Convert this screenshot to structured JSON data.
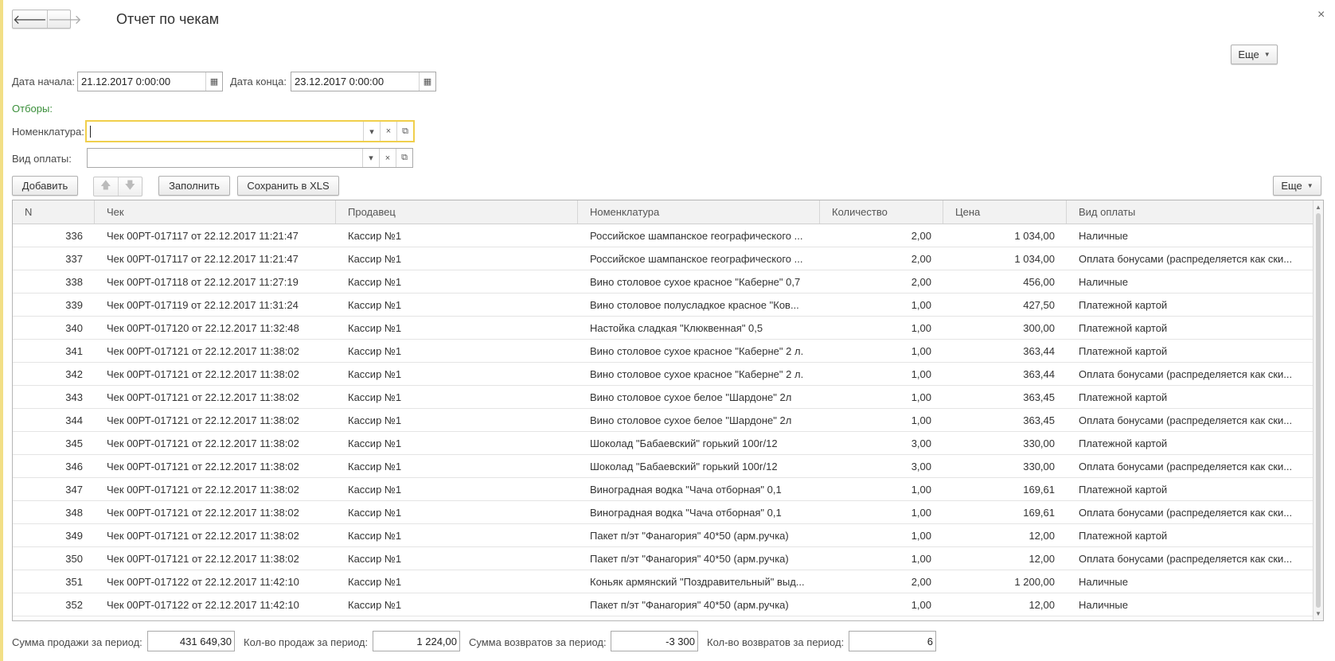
{
  "window": {
    "title": "Отчет по чекам",
    "close": "×"
  },
  "nav": {
    "back": "🡐",
    "forward": "🡒"
  },
  "more_label": "Еще",
  "filters": {
    "start_label": "Дата начала:",
    "start_value": "21.12.2017  0:00:00",
    "end_label": "Дата конца:",
    "end_value": "23.12.2017  0:00:00",
    "selections_label": "Отборы:",
    "nomenclature_label": "Номенклатура:",
    "nomenclature_value": "",
    "payment_label": "Вид оплаты:",
    "payment_value": ""
  },
  "toolbar": {
    "add": "Добавить",
    "fill": "Заполнить",
    "save_xls": "Сохранить в XLS"
  },
  "table": {
    "columns": [
      "N",
      "Чек",
      "Продавец",
      "Номенклатура",
      "Количество",
      "Цена",
      "Вид оплаты"
    ],
    "rows": [
      [
        "336",
        "Чек 00РТ-017117 от 22.12.2017 11:21:47",
        "Кассир №1",
        "Российское шампанское географического ...",
        "2,00",
        "1 034,00",
        "Наличные"
      ],
      [
        "337",
        "Чек 00РТ-017117 от 22.12.2017 11:21:47",
        "Кассир №1",
        "Российское шампанское географического ...",
        "2,00",
        "1 034,00",
        "Оплата бонусами (распределяется как ски..."
      ],
      [
        "338",
        "Чек 00РТ-017118 от 22.12.2017 11:27:19",
        "Кассир №1",
        "Вино столовое сухое красное \"Каберне\" 0,7",
        "2,00",
        "456,00",
        "Наличные"
      ],
      [
        "339",
        "Чек 00РТ-017119 от 22.12.2017 11:31:24",
        "Кассир №1",
        "Вино столовое полусладкое  красное \"Ков...",
        "1,00",
        "427,50",
        "Платежной картой"
      ],
      [
        "340",
        "Чек 00РТ-017120 от 22.12.2017 11:32:48",
        "Кассир №1",
        "Настойка сладкая \"Клюквенная\" 0,5",
        "1,00",
        "300,00",
        "Платежной картой"
      ],
      [
        "341",
        "Чек 00РТ-017121 от 22.12.2017 11:38:02",
        "Кассир №1",
        "Вино столовое сухое красное \"Каберне\" 2 л.",
        "1,00",
        "363,44",
        "Платежной картой"
      ],
      [
        "342",
        "Чек 00РТ-017121 от 22.12.2017 11:38:02",
        "Кассир №1",
        "Вино столовое сухое красное \"Каберне\" 2 л.",
        "1,00",
        "363,44",
        "Оплата бонусами (распределяется как ски..."
      ],
      [
        "343",
        "Чек 00РТ-017121 от 22.12.2017 11:38:02",
        "Кассир №1",
        "Вино столовое сухое белое \"Шардоне\" 2л",
        "1,00",
        "363,45",
        "Платежной картой"
      ],
      [
        "344",
        "Чек 00РТ-017121 от 22.12.2017 11:38:02",
        "Кассир №1",
        "Вино столовое сухое белое \"Шардоне\" 2л",
        "1,00",
        "363,45",
        "Оплата бонусами (распределяется как ски..."
      ],
      [
        "345",
        "Чек 00РТ-017121 от 22.12.2017 11:38:02",
        "Кассир №1",
        "Шоколад \"Бабаевский\" горький 100г/12",
        "3,00",
        "330,00",
        "Платежной картой"
      ],
      [
        "346",
        "Чек 00РТ-017121 от 22.12.2017 11:38:02",
        "Кассир №1",
        "Шоколад \"Бабаевский\" горький 100г/12",
        "3,00",
        "330,00",
        "Оплата бонусами (распределяется как ски..."
      ],
      [
        "347",
        "Чек 00РТ-017121 от 22.12.2017 11:38:02",
        "Кассир №1",
        "Виноградная водка \"Чача отборная\" 0,1",
        "1,00",
        "169,61",
        "Платежной картой"
      ],
      [
        "348",
        "Чек 00РТ-017121 от 22.12.2017 11:38:02",
        "Кассир №1",
        "Виноградная водка \"Чача отборная\" 0,1",
        "1,00",
        "169,61",
        "Оплата бонусами (распределяется как ски..."
      ],
      [
        "349",
        "Чек 00РТ-017121 от 22.12.2017 11:38:02",
        "Кассир №1",
        "Пакет п/эт \"Фанагория\" 40*50 (арм.ручка)",
        "1,00",
        "12,00",
        "Платежной картой"
      ],
      [
        "350",
        "Чек 00РТ-017121 от 22.12.2017 11:38:02",
        "Кассир №1",
        "Пакет п/эт \"Фанагория\" 40*50 (арм.ручка)",
        "1,00",
        "12,00",
        "Оплата бонусами (распределяется как ски..."
      ],
      [
        "351",
        "Чек 00РТ-017122 от 22.12.2017 11:42:10",
        "Кассир №1",
        "Коньяк армянский \"Поздравительный\" выд...",
        "2,00",
        "1 200,00",
        "Наличные"
      ],
      [
        "352",
        "Чек 00РТ-017122 от 22.12.2017 11:42:10",
        "Кассир №1",
        "Пакет п/эт \"Фанагория\" 40*50 (арм.ручка)",
        "1,00",
        "12,00",
        "Наличные"
      ]
    ]
  },
  "summary": {
    "sales_sum_label": "Сумма продажи за период:",
    "sales_sum": "431 649,30",
    "sales_count_label": "Кол-во продаж за период:",
    "sales_count": "1 224,00",
    "returns_sum_label": "Сумма возвратов за период:",
    "returns_sum": "-3 300",
    "returns_count_label": "Кол-во возвратов за период:",
    "returns_count": "6"
  }
}
